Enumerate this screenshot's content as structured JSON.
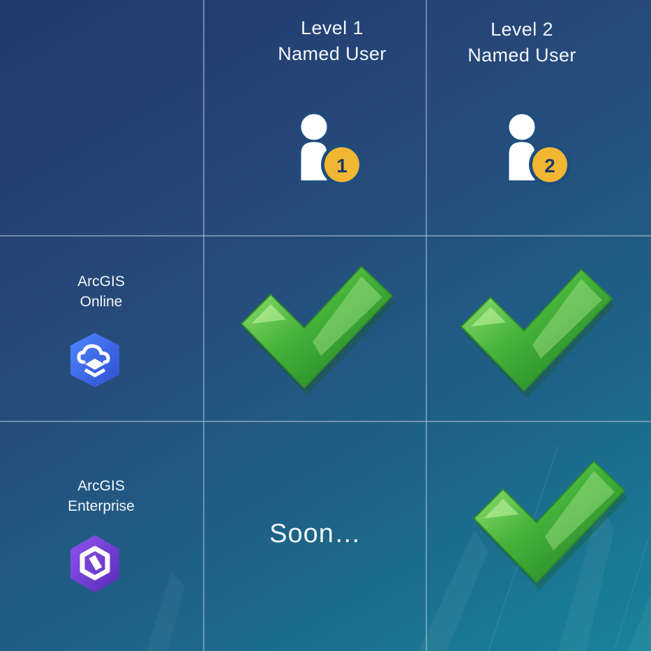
{
  "columns": [
    {
      "line1": "Level 1",
      "line2": "Named User",
      "badge": "1",
      "icon": "named-user-level-1-icon"
    },
    {
      "line1": "Level 2",
      "line2": "Named User",
      "badge": "2",
      "icon": "named-user-level-2-icon"
    }
  ],
  "rows": [
    {
      "line1": "ArcGIS",
      "line2": "Online",
      "icon": "arcgis-online-icon",
      "level1": "check",
      "level2": "check"
    },
    {
      "line1": "ArcGIS",
      "line2": "Enterprise",
      "icon": "arcgis-enterprise-icon",
      "level1": "Soon…",
      "level2": "check"
    }
  ],
  "colors": {
    "badge": "#f2b632",
    "badge_border": "#1d4e7e",
    "user": "#ffffff",
    "check_light": "#8fe26a",
    "check_dark": "#1e7f22",
    "online_icon": "#3b6ef0",
    "enterprise_icon": "#7a3fd9"
  }
}
